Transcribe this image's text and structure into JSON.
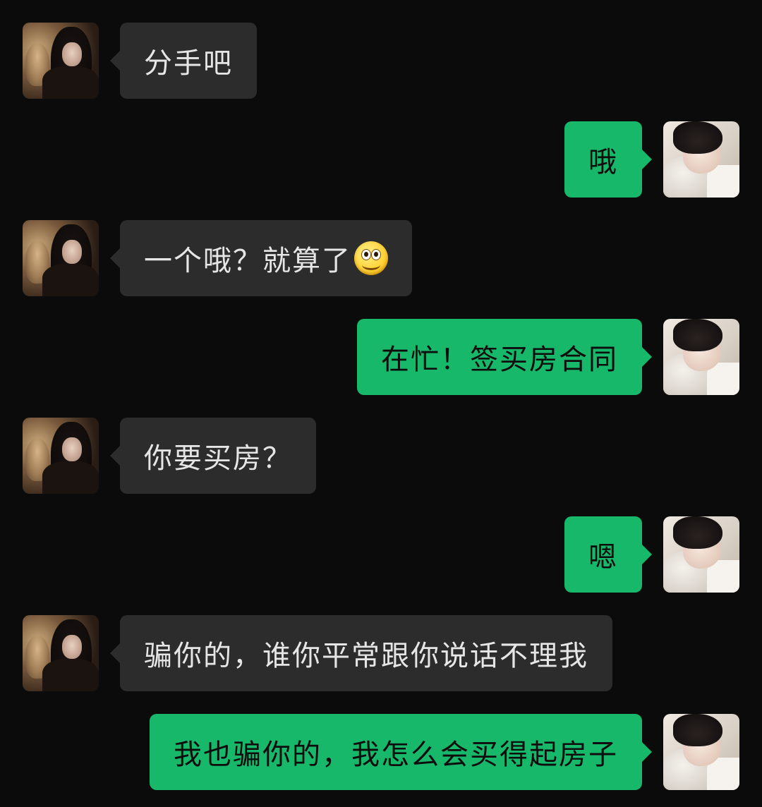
{
  "messages": [
    {
      "side": "in",
      "text": "分手吧"
    },
    {
      "side": "out",
      "text": "哦"
    },
    {
      "side": "in",
      "text": "一个哦？就算了",
      "emoji": "smile-emoji"
    },
    {
      "side": "out",
      "text": "在忙！签买房合同"
    },
    {
      "side": "in",
      "text": "你要买房？"
    },
    {
      "side": "out",
      "text": "嗯"
    },
    {
      "side": "in",
      "text": "骗你的，谁你平常跟你说话不理我"
    },
    {
      "side": "out",
      "text": "我也骗你的，我怎么会买得起房子"
    }
  ],
  "avatars": {
    "in": "girl-avatar",
    "out": "boy-avatar"
  },
  "colors": {
    "background": "#0b0b0b",
    "incoming_bubble": "#2c2c2c",
    "outgoing_bubble": "#18b86a"
  }
}
